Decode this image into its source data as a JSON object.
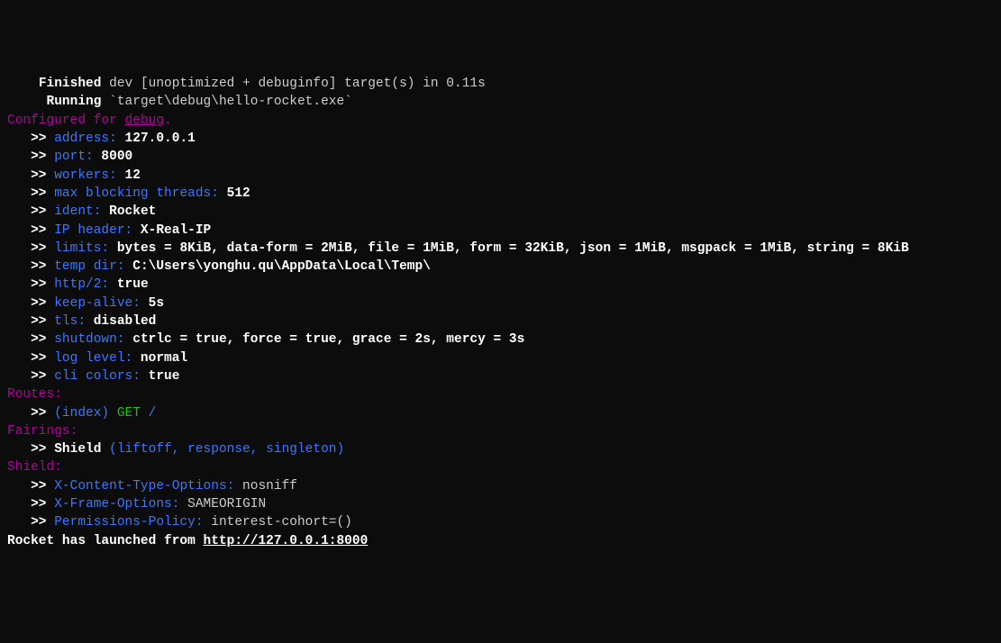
{
  "compile": {
    "finished_label": "Finished",
    "finished_detail": " dev [unoptimized + debuginfo] target(s) in 0.11s",
    "running_label": "Running",
    "running_detail": " `target\\debug\\hello-rocket.exe`"
  },
  "configured": {
    "prefix": "Configured for ",
    "profile": "debug",
    "suffix": "."
  },
  "arrow": "   >> ",
  "config": [
    {
      "key": "address:",
      "val": " 127.0.0.1",
      "bold": true
    },
    {
      "key": "port:",
      "val": " 8000",
      "bold": true
    },
    {
      "key": "workers:",
      "val": " 12",
      "bold": true
    },
    {
      "key": "max blocking threads:",
      "val": " 512",
      "bold": true
    },
    {
      "key": "ident:",
      "val": " Rocket",
      "bold": true
    },
    {
      "key": "IP header:",
      "val": " X-Real-IP",
      "bold": true
    },
    {
      "key": "limits:",
      "val": " bytes = 8KiB, data-form = 2MiB, file = 1MiB, form = 32KiB, json = 1MiB, msgpack = 1MiB, string = 8KiB",
      "bold": true
    },
    {
      "key": "temp dir:",
      "val": " C:\\Users\\yonghu.qu\\AppData\\Local\\Temp\\",
      "bold": true
    },
    {
      "key": "http/2:",
      "val": " true",
      "bold": true
    },
    {
      "key": "keep-alive:",
      "val": " 5s",
      "bold": true
    },
    {
      "key": "tls:",
      "val": " disabled",
      "bold": true
    },
    {
      "key": "shutdown:",
      "val": " ctrlc = true, force = true, grace = 2s, mercy = 3s",
      "bold": true
    },
    {
      "key": "log level:",
      "val": " normal",
      "bold": true
    },
    {
      "key": "cli colors:",
      "val": " true",
      "bold": true
    }
  ],
  "routes": {
    "header": "Routes",
    "name": "(index)",
    "method": " GET",
    "path": " /"
  },
  "fairings": {
    "header": "Fairings",
    "name": "Shield ",
    "detail": "(liftoff, response, singleton)"
  },
  "shield": {
    "header": "Shield",
    "items": [
      {
        "key": "X-Content-Type-Options:",
        "val": " nosniff"
      },
      {
        "key": "X-Frame-Options:",
        "val": " SAMEORIGIN"
      },
      {
        "key": "Permissions-Policy:",
        "val": " interest-cohort=()"
      }
    ]
  },
  "launch": {
    "prefix": "Rocket has launched from ",
    "url": "http://127.0.0.1:8000"
  }
}
